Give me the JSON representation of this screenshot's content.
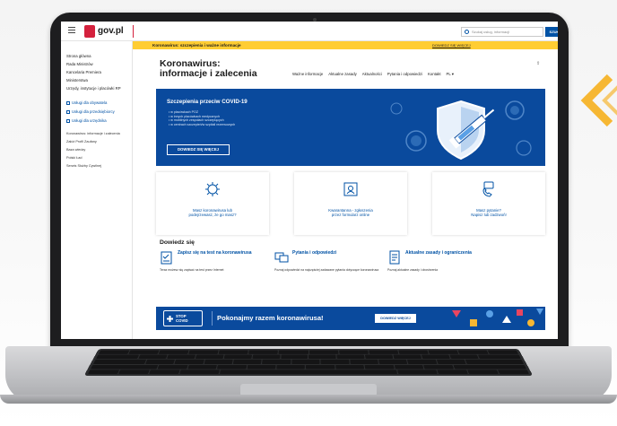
{
  "site": {
    "logo_text": "gov.pl"
  },
  "search": {
    "placeholder": "Szukaj usług, informacji",
    "button_label": "SZUK"
  },
  "sidebar": {
    "items": [
      "Strona główna",
      "Rada Ministrów",
      "Kancelaria Premiera",
      "Ministerstwa",
      "Urzędy, instytucje i placówki RP"
    ],
    "services": [
      {
        "label": "Usługi dla obywatela",
        "icon": "person-icon"
      },
      {
        "label": "Usługi dla przedsiębiorcy",
        "icon": "briefcase-icon"
      },
      {
        "label": "Usługi dla urzędnika",
        "icon": "folder-icon"
      }
    ],
    "extra": [
      "Koronawirus: informacje i zalecenia",
      "Załóż Profil Zaufany",
      "Baza wiedzy",
      "Polski Ład",
      "Serwis Służby Cywilnej"
    ]
  },
  "alert": {
    "text": "Koronawirus: szczepienia i ważne informacje",
    "link": "DOWIEDZ SIĘ WIĘCEJ"
  },
  "page": {
    "title_line1": "Koronawirus:",
    "title_line2": "informacje i zalecenia"
  },
  "nav": {
    "tabs": [
      "Ważne informacje",
      "Aktualne zasady",
      "Aktualności",
      "Pytania i odpowiedzi",
      "Kontakt",
      "PL ▾"
    ]
  },
  "hero": {
    "title": "Szczepienia przeciw COVID-19",
    "list": [
      "w placówkach POZ",
      "w innych placówkach medycznych",
      "w mobilnych zespołach szczepiących",
      "w centrach szczepień/w szpitali rezerwowych"
    ],
    "button": "DOWIEDZ SIĘ WIĘCEJ"
  },
  "cards": [
    {
      "line1": "Masz koronawirusa lub",
      "line2": "podejrzewasz, że go masz?"
    },
    {
      "line1": "Kwarantanna - zgłoszenia",
      "line2": "przez formularz online"
    },
    {
      "line1": "Masz pytanie?",
      "line2": "Napisz lub zadzwoń!"
    }
  ],
  "section": {
    "title": "Dowiedz się"
  },
  "info": [
    {
      "title": "Zapisz się na test na koronawirusa",
      "desc": "Teraz możesz się zapisać na test przez Internet"
    },
    {
      "title": "Pytania i odpowiedzi",
      "desc": "Poznaj odpowiedzi na najczęściej zadawane pytania dotyczące koronawirusa"
    },
    {
      "title": "Aktualne zasady i ograniczenia",
      "desc": "Poznaj aktualne zasady i obostrzenia"
    }
  ],
  "banner": {
    "logo_line1": "STOP",
    "logo_line2": "COVID",
    "title": "Pokonajmy razem koronawirusa!",
    "button": "DOWIEDZ WIĘCEJ"
  },
  "colors": {
    "brand_blue": "#0a4a9d",
    "link_blue": "#0052a5",
    "alert_yellow": "#ffcd33",
    "gov_red": "#d4213d",
    "accent_orange": "#f6b733"
  }
}
